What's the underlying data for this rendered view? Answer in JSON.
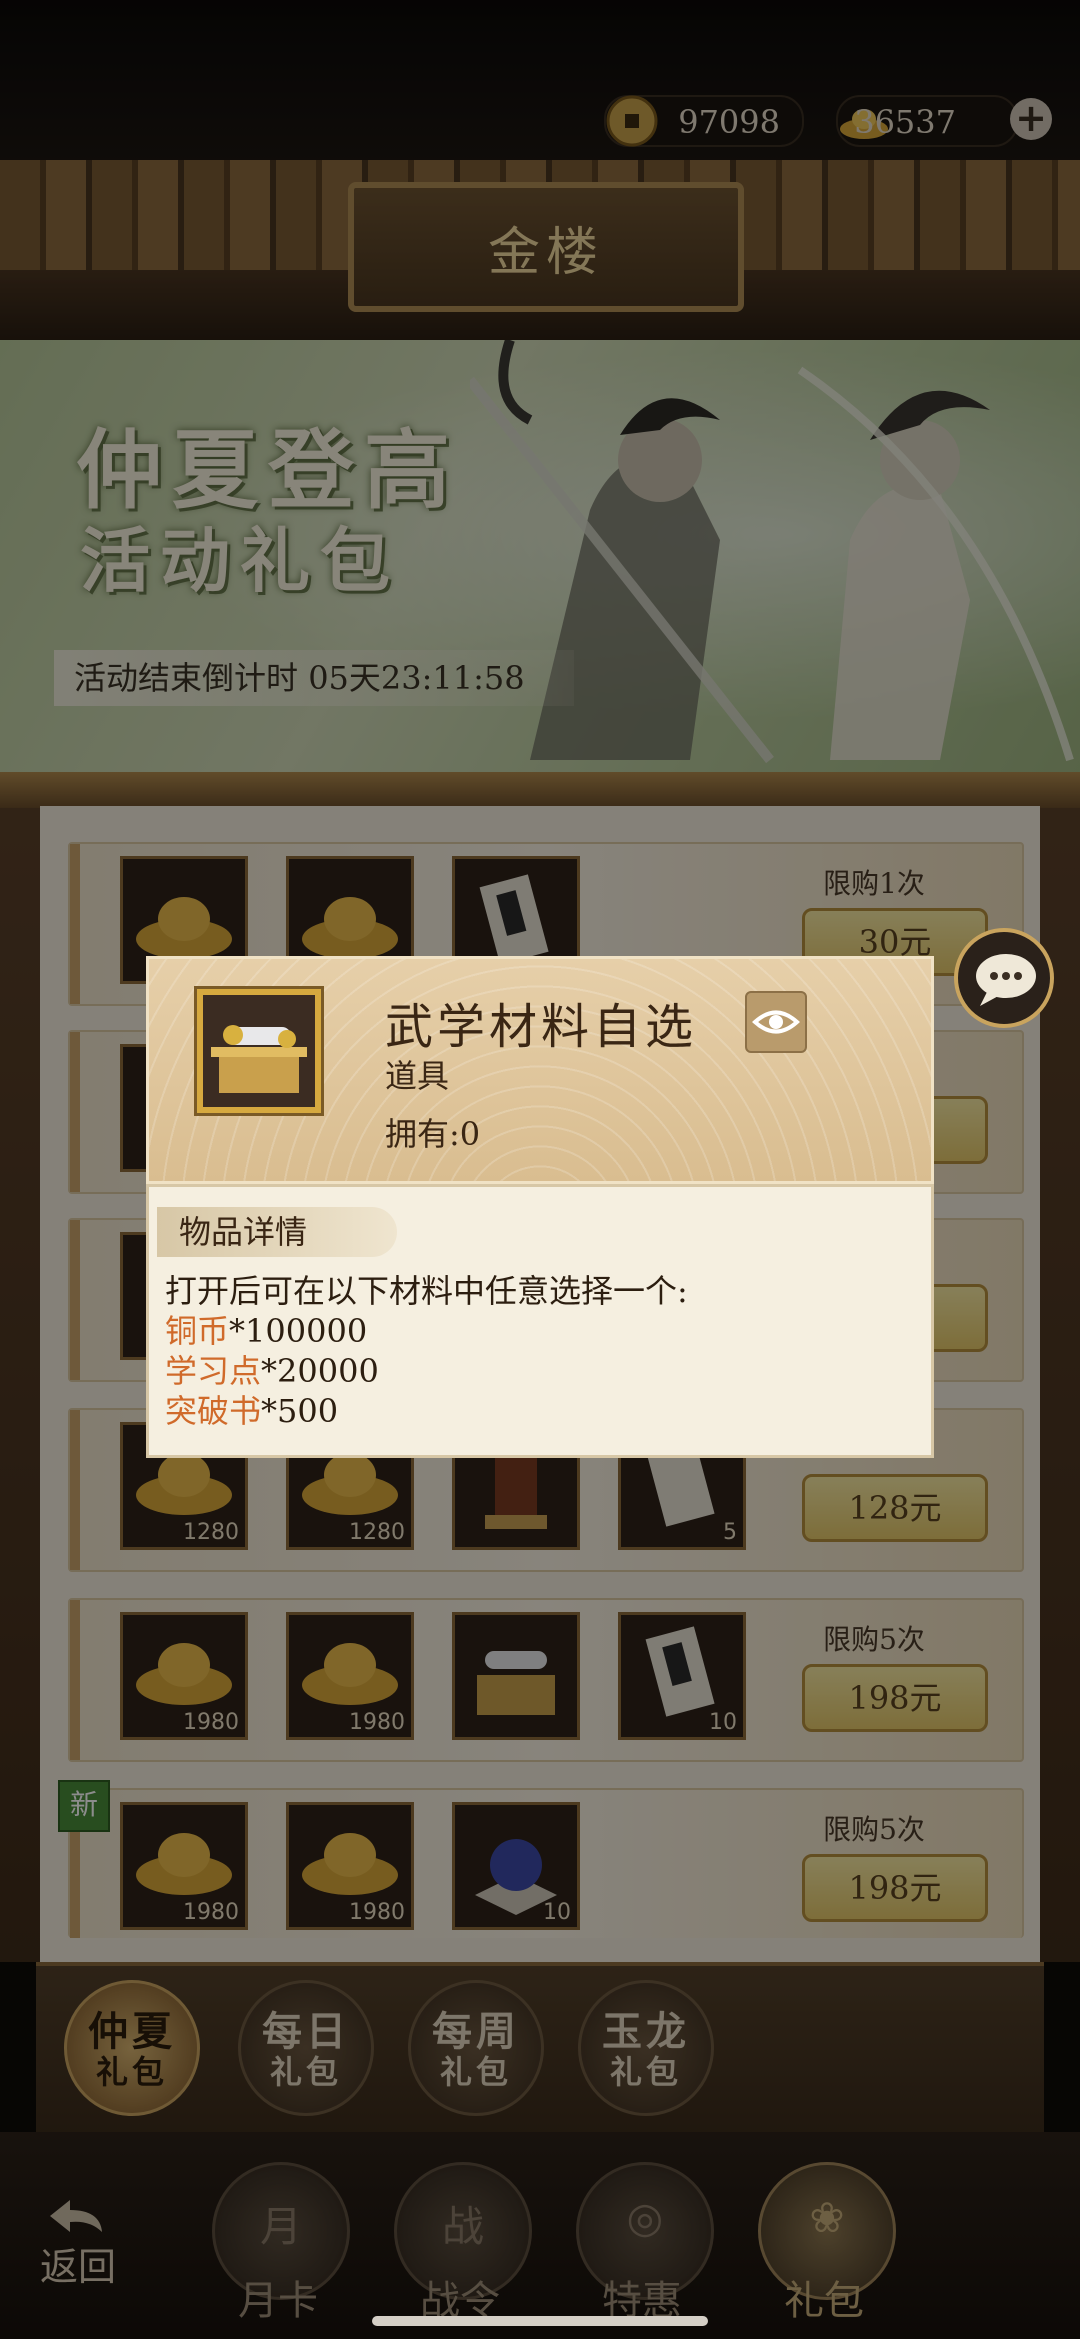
{
  "currency": {
    "coins": "97098",
    "ingots": "36537",
    "add": "+"
  },
  "header": {
    "title": "金楼"
  },
  "banner": {
    "title": "仲夏登高",
    "subtitle": "活动礼包",
    "countdown_label": "活动结束倒计时",
    "countdown_value": "05天23:11:58"
  },
  "packs": [
    {
      "limit": "限购1次",
      "price": "30元",
      "items": []
    },
    {
      "limit": "",
      "price": "",
      "items": []
    },
    {
      "limit": "",
      "price": "",
      "items": []
    },
    {
      "limit": "",
      "price": "128元",
      "items": [
        "1280",
        "1280",
        "",
        "5"
      ]
    },
    {
      "limit": "限购5次",
      "price": "198元",
      "items": [
        "1980",
        "1980",
        "",
        "10"
      ]
    },
    {
      "limit": "限购5次",
      "price": "198元",
      "items": [
        "1980",
        "1980",
        "10"
      ],
      "new_tag": "新"
    }
  ],
  "category_tabs": [
    {
      "l1": "仲夏",
      "l2": "礼包",
      "active": true
    },
    {
      "l1": "每日",
      "l2": "礼包"
    },
    {
      "l1": "每周",
      "l2": "礼包"
    },
    {
      "l1": "玉龙",
      "l2": "礼包"
    }
  ],
  "bottom_nav": {
    "back": "返回",
    "items": [
      {
        "label": "月卡",
        "glyph": "月"
      },
      {
        "label": "战令",
        "glyph": "战"
      },
      {
        "label": "特惠",
        "glyph": "◎"
      },
      {
        "label": "礼包",
        "glyph": "❀"
      }
    ]
  },
  "popup": {
    "name": "武学材料自选",
    "type": "道具",
    "owned": "拥有:0",
    "detail_tab": "物品详情",
    "desc_intro": "打开后可在以下材料中任意选择一个:",
    "options": [
      {
        "name": "铜币",
        "amount": "*100000"
      },
      {
        "name": "学习点",
        "amount": "*20000"
      },
      {
        "name": "突破书",
        "amount": "*500"
      }
    ]
  },
  "colors": {
    "accent_gold": "#d6a93f",
    "price_button": "#f0dc8a",
    "highlight_orange": "#d06a2a",
    "new_tag_green": "#4a8d3a"
  },
  "icons": {
    "coin": "coin-icon",
    "ingot": "gold-ingot-icon",
    "eye": "eye-icon",
    "chat": "chat-bubble-icon",
    "back": "back-arrow-icon"
  }
}
